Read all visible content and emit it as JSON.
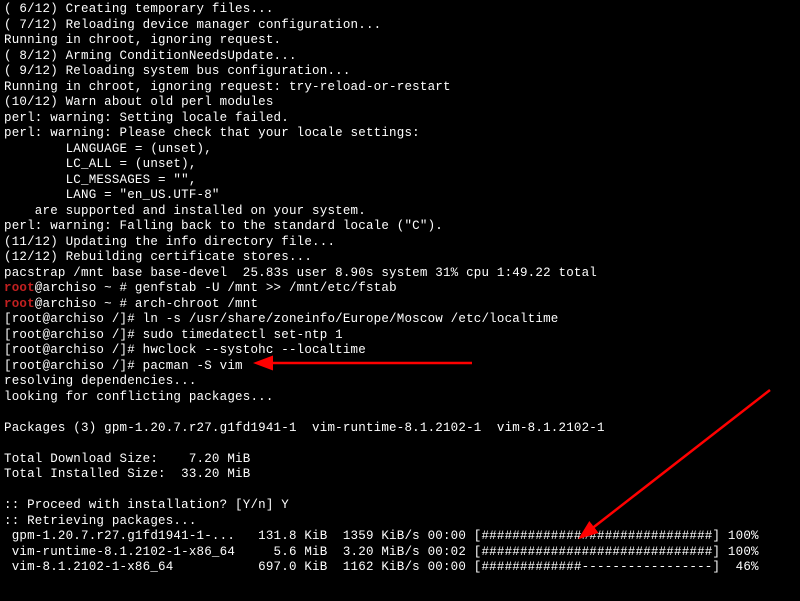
{
  "lines": [
    {
      "segs": [
        {
          "t": "( 6/12) Creating temporary files..."
        }
      ]
    },
    {
      "segs": [
        {
          "t": "( 7/12) Reloading device manager configuration..."
        }
      ]
    },
    {
      "segs": [
        {
          "t": "Running in chroot, ignoring request."
        }
      ]
    },
    {
      "segs": [
        {
          "t": "( 8/12) Arming ConditionNeedsUpdate..."
        }
      ]
    },
    {
      "segs": [
        {
          "t": "( 9/12) Reloading system bus configuration..."
        }
      ]
    },
    {
      "segs": [
        {
          "t": "Running in chroot, ignoring request: try-reload-or-restart"
        }
      ]
    },
    {
      "segs": [
        {
          "t": "(10/12) Warn about old perl modules"
        }
      ]
    },
    {
      "segs": [
        {
          "t": "perl: warning: Setting locale failed."
        }
      ]
    },
    {
      "segs": [
        {
          "t": "perl: warning: Please check that your locale settings:"
        }
      ]
    },
    {
      "segs": [
        {
          "t": "        LANGUAGE = (unset),"
        }
      ]
    },
    {
      "segs": [
        {
          "t": "        LC_ALL = (unset),"
        }
      ]
    },
    {
      "segs": [
        {
          "t": "        LC_MESSAGES = \"\","
        }
      ]
    },
    {
      "segs": [
        {
          "t": "        LANG = \"en_US.UTF-8\""
        }
      ]
    },
    {
      "segs": [
        {
          "t": "    are supported and installed on your system."
        }
      ]
    },
    {
      "segs": [
        {
          "t": "perl: warning: Falling back to the standard locale (\"C\")."
        }
      ]
    },
    {
      "segs": [
        {
          "t": "(11/12) Updating the info directory file..."
        }
      ]
    },
    {
      "segs": [
        {
          "t": "(12/12) Rebuilding certificate stores..."
        }
      ]
    },
    {
      "segs": [
        {
          "t": "pacstrap /mnt base base-devel  25.83s user 8.90s system 31% cpu 1:49.22 total"
        }
      ]
    },
    {
      "segs": [
        {
          "t": "root",
          "c": "red"
        },
        {
          "t": "@archiso ~ # genfstab -U /mnt >> /mnt/etc/fstab"
        }
      ]
    },
    {
      "segs": [
        {
          "t": "root",
          "c": "red"
        },
        {
          "t": "@archiso ~ # arch-chroot /mnt"
        }
      ]
    },
    {
      "segs": [
        {
          "t": "[root@archiso /]# ln -s /usr/share/zoneinfo/Europe/Moscow /etc/localtime"
        }
      ]
    },
    {
      "segs": [
        {
          "t": "[root@archiso /]# sudo timedatectl set-ntp 1"
        }
      ]
    },
    {
      "segs": [
        {
          "t": "[root@archiso /]# hwclock --systohc --localtime"
        }
      ]
    },
    {
      "segs": [
        {
          "t": "[root@archiso /]# pacman -S vim"
        }
      ]
    },
    {
      "segs": [
        {
          "t": "resolving dependencies..."
        }
      ]
    },
    {
      "segs": [
        {
          "t": "looking for conflicting packages..."
        }
      ]
    },
    {
      "segs": [
        {
          "t": ""
        }
      ]
    },
    {
      "segs": [
        {
          "t": "Packages (3) gpm-1.20.7.r27.g1fd1941-1  vim-runtime-8.1.2102-1  vim-8.1.2102-1"
        }
      ]
    },
    {
      "segs": [
        {
          "t": ""
        }
      ]
    },
    {
      "segs": [
        {
          "t": "Total Download Size:    7.20 MiB"
        }
      ]
    },
    {
      "segs": [
        {
          "t": "Total Installed Size:  33.20 MiB"
        }
      ]
    },
    {
      "segs": [
        {
          "t": ""
        }
      ]
    },
    {
      "segs": [
        {
          "t": ":: Proceed with installation? [Y/n] Y"
        }
      ]
    },
    {
      "segs": [
        {
          "t": ":: Retrieving packages..."
        }
      ]
    },
    {
      "segs": [
        {
          "t": " gpm-1.20.7.r27.g1fd1941-1-...   131.8 KiB  1359 KiB/s 00:00 [##############################] 100%"
        }
      ]
    },
    {
      "segs": [
        {
          "t": " vim-runtime-8.1.2102-1-x86_64     5.6 MiB  3.20 MiB/s 00:02 [##############################] 100%"
        }
      ]
    },
    {
      "segs": [
        {
          "t": " vim-8.1.2102-1-x86_64           697.0 KiB  1162 KiB/s 00:00 [#############-----------------]  46%"
        }
      ]
    }
  ]
}
